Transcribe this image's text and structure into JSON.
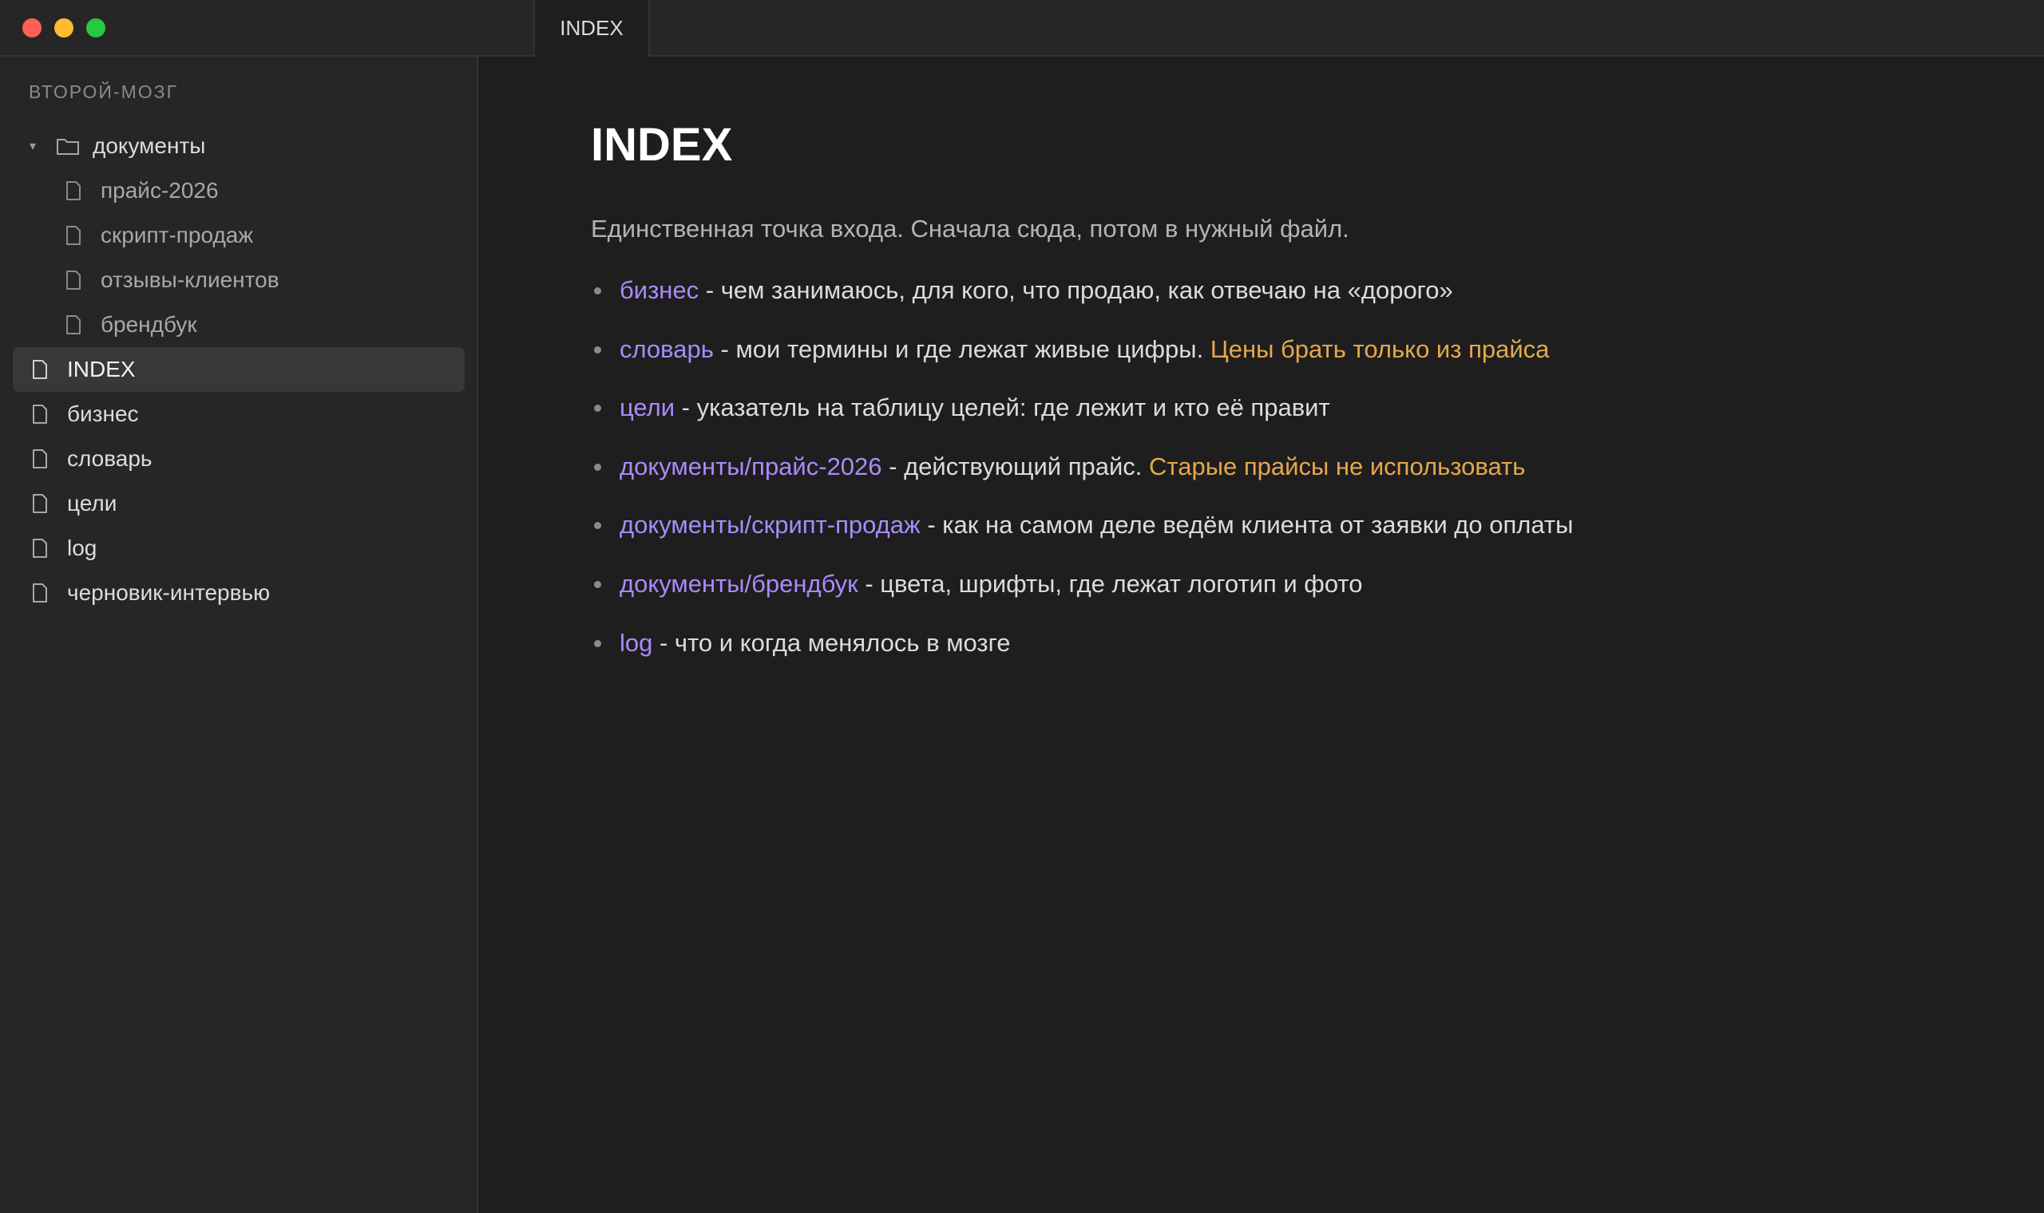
{
  "window": {
    "tab_title": "INDEX"
  },
  "sidebar": {
    "vault_name": "ВТОРОЙ-МОЗГ",
    "folder": {
      "label": "документы",
      "children": [
        "прайс-2026",
        "скрипт-продаж",
        "отзывы-клиентов",
        "брендбук"
      ]
    },
    "files": [
      "INDEX",
      "бизнес",
      "словарь",
      "цели",
      "log",
      "черновик-интервью"
    ],
    "active_file": "INDEX"
  },
  "document": {
    "title": "INDEX",
    "intro": "Единственная точка входа. Сначала сюда, потом в нужный файл.",
    "items": [
      {
        "link": "бизнес",
        "text": " - чем занимаюсь, для кого, что продаю, как отвечаю на «дорого»",
        "note": ""
      },
      {
        "link": "словарь",
        "text": " - мои термины и где лежат живые цифры. ",
        "note": "Цены брать только из прайса"
      },
      {
        "link": "цели",
        "text": " - указатель на таблицу целей: где лежит и кто её правит",
        "note": ""
      },
      {
        "link": "документы/прайс-2026",
        "text": " - действующий прайс. ",
        "note": "Старые прайсы не использовать"
      },
      {
        "link": "документы/скрипт-продаж",
        "text": " - как на самом деле ведём клиента от заявки до оплаты",
        "note": ""
      },
      {
        "link": "документы/брендбук",
        "text": " - цвета, шрифты, где лежат логотип и фото",
        "note": ""
      },
      {
        "link": "log",
        "text": " - что и когда менялось в мозге",
        "note": ""
      }
    ]
  },
  "colors": {
    "link": "#a88bfa",
    "warning": "#e5a84b",
    "traffic_close": "#ff5f57",
    "traffic_minimize": "#febc2e",
    "traffic_maximize": "#28c840"
  }
}
